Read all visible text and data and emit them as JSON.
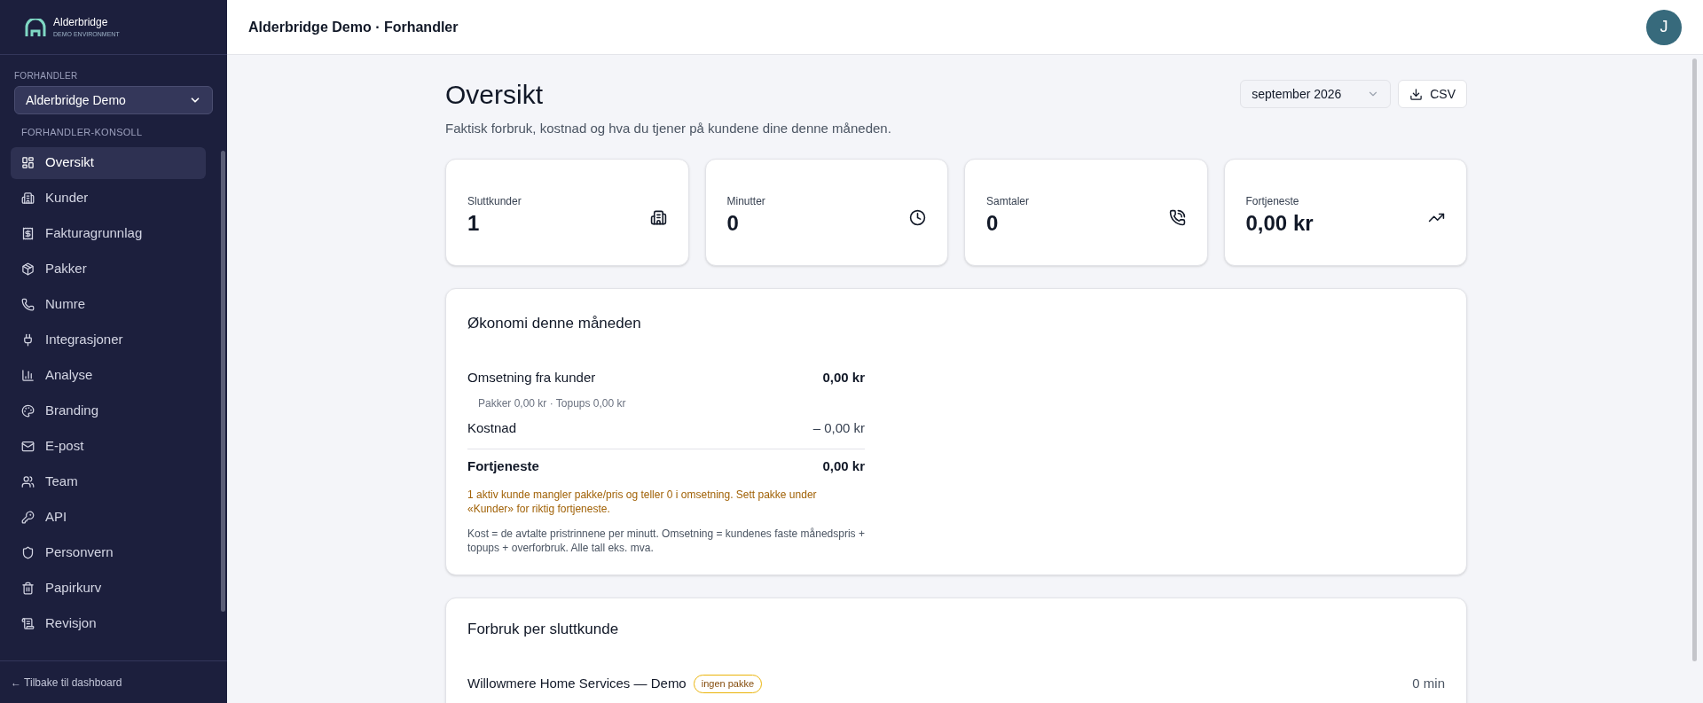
{
  "sidebar": {
    "logo": {
      "name": "Alderbridge",
      "tagline": "DEMO ENVIRONMENT"
    },
    "org_label": "FORHANDLER",
    "org_select": {
      "value": "Alderbridge Demo"
    },
    "section_label": "FORHANDLER-KONSOLL",
    "items": [
      {
        "label": "Oversikt",
        "selected": true
      },
      {
        "label": "Kunder",
        "selected": false
      },
      {
        "label": "Fakturagrunnlag",
        "selected": false
      },
      {
        "label": "Pakker",
        "selected": false
      },
      {
        "label": "Numre",
        "selected": false
      },
      {
        "label": "Integrasjoner",
        "selected": false
      },
      {
        "label": "Analyse",
        "selected": false
      },
      {
        "label": "Branding",
        "selected": false
      },
      {
        "label": "E-post",
        "selected": false
      },
      {
        "label": "Team",
        "selected": false
      },
      {
        "label": "API",
        "selected": false
      },
      {
        "label": "Personvern",
        "selected": false
      },
      {
        "label": "Papirkurv",
        "selected": false
      },
      {
        "label": "Revisjon",
        "selected": false
      }
    ],
    "back_link": "← Tilbake til dashboard"
  },
  "header": {
    "title": "Alderbridge Demo · Forhandler",
    "avatar": "J"
  },
  "page": {
    "title": "Oversikt",
    "subtitle": "Faktisk forbruk, kostnad og hva du tjener på kundene dine denne måneden.",
    "month_select": {
      "value": "september 2026"
    },
    "export_button": "CSV"
  },
  "stats": [
    {
      "label": "Sluttkunder",
      "value": "1"
    },
    {
      "label": "Minutter",
      "value": "0"
    },
    {
      "label": "Samtaler",
      "value": "0"
    },
    {
      "label": "Fortjeneste",
      "value": "0,00 kr"
    }
  ],
  "economy": {
    "title": "Økonomi denne måneden",
    "rows": [
      {
        "kind": "line",
        "label": "Omsetning fra kunder",
        "value": "0,00 kr"
      },
      {
        "kind": "detail",
        "label": "Pakker 0,00 kr · Topups 0,00 kr"
      },
      {
        "kind": "line",
        "label": "Kostnad",
        "value": "– 0,00 kr"
      },
      {
        "kind": "total",
        "label": "Fortjeneste",
        "value": "0,00 kr"
      }
    ],
    "warning": "1 aktiv kunde mangler pakke/pris og teller 0 i omsetning. Sett pakke under «Kunder» for riktig fortjeneste.",
    "note": "Kost = de avtalte pristrinnene per minutt. Omsetning = kundenes faste månedspris + topups + overforbruk. Alle tall eks. mva."
  },
  "usage": {
    "title": "Forbruk per sluttkunde",
    "rows": [
      {
        "name": "Willowmere Home Services — Demo",
        "badge": "ingen pakke",
        "minutes": "0 min"
      }
    ]
  }
}
